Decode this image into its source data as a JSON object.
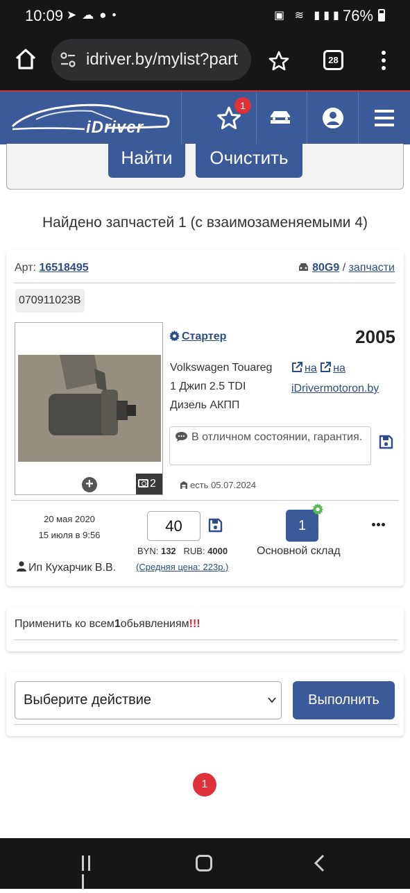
{
  "status_bar": {
    "time": "10:09",
    "battery": "76%"
  },
  "browser": {
    "url": "idriver.by/mylist?part",
    "tab_count": "28"
  },
  "header": {
    "logo_text": "iDriver",
    "favorites_badge": "1"
  },
  "search": {
    "find_label": "Найти",
    "clear_label": "Очистить"
  },
  "results": {
    "found_text": "Найдено запчастей 1 (с взаимозаменяемыми 4)"
  },
  "part": {
    "art_prefix": "Арт: ",
    "art_number": "16518495",
    "model_code": "80G9",
    "model_sep": " / ",
    "parts_link": "запчасти",
    "oem": "070911023B",
    "photo_count": "2",
    "photo_add": "+",
    "name": "Стартер",
    "year": "2005",
    "car_line1": "Volkswagen Touareg",
    "car_line2": "1 Джип 2.5 TDI",
    "car_line3": "Дизель АКПП",
    "link_na_1": "на",
    "link_na_2": "на",
    "site_link": "iDrivermotoron.by",
    "comment": "В отличном состоянии, гарантия.",
    "stock": "есть 05.07.2024",
    "date_added": "20 мая 2020",
    "date_updated": "15 июля в 9:56",
    "seller": "Ип Кухарчик В.В.",
    "price": "40",
    "byn_label": "BYN: ",
    "byn_value": "132",
    "rub_label": "RUB: ",
    "rub_value": "4000",
    "avg_price": "(Средняя цена: 223р.)",
    "quantity": "1",
    "warehouse": "Основной склад"
  },
  "apply": {
    "text_before": "Применить ко всем",
    "count": "1",
    "text_after": "обьявлениям",
    "exclaim": "!!!"
  },
  "action": {
    "select_value": "Выберите действие",
    "execute_label": "Выполнить"
  },
  "pagination": {
    "current_page": "1"
  },
  "colors": {
    "brand_blue": "#3a5a9a",
    "badge_red": "#e0303a",
    "link_blue": "#2c4d8a"
  }
}
